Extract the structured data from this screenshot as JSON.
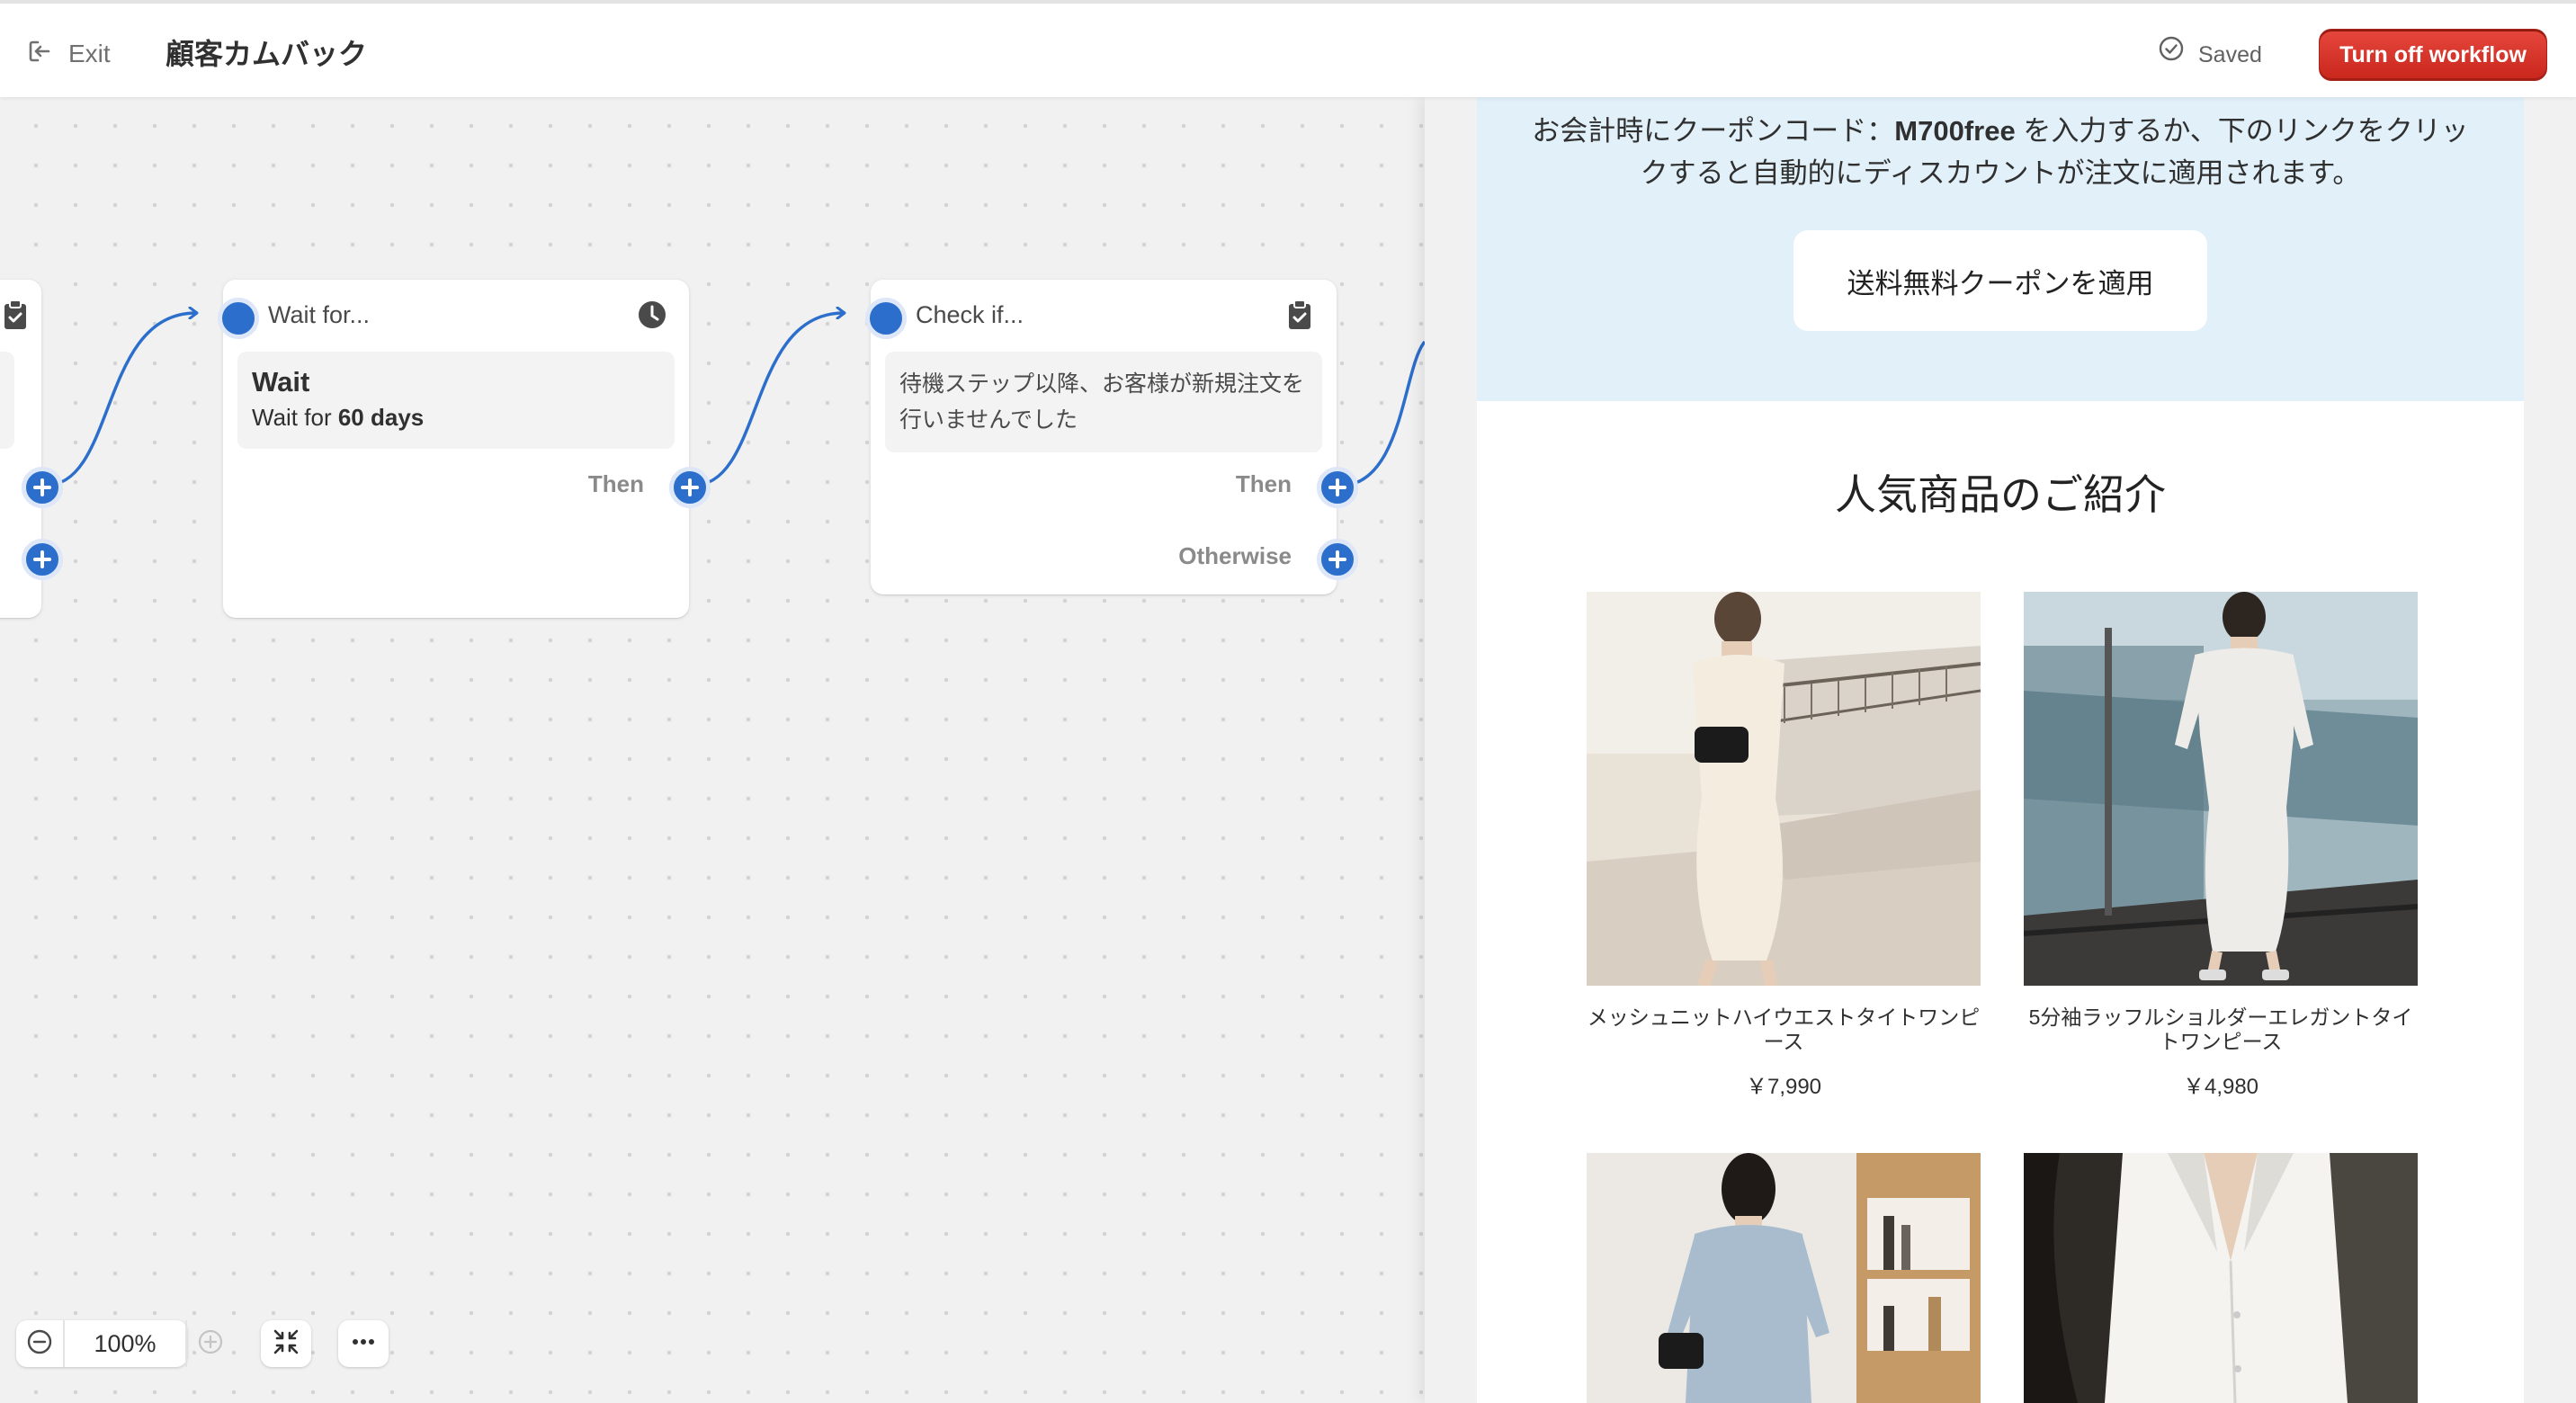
{
  "topbar": {
    "exit_label": "Exit",
    "workflow_title": "顧客カムバック",
    "saved_label": "Saved",
    "turn_off_label": "Turn off workflow"
  },
  "canvas": {
    "nodes": {
      "wait": {
        "header": "Wait for...",
        "heading": "Wait",
        "desc_prefix": "Wait for ",
        "desc_value": "60 days",
        "then_label": "Then"
      },
      "check": {
        "header": "Check if...",
        "condition": "待機ステップ以降、お客様が新規注文を行いませんでした",
        "then_label": "Then",
        "otherwise_label": "Otherwise"
      }
    },
    "zoom": {
      "level": "100%"
    },
    "icons": [
      "clipboard-check-icon",
      "clock-icon",
      "plus-circle-icon",
      "zoom-out-icon",
      "zoom-in-icon",
      "fit-view-icon",
      "more-horizontal-icon",
      "exit-icon",
      "check-circle-icon"
    ]
  },
  "email": {
    "coupon_text_pre": "お会計時にクーポンコード：",
    "coupon_code": "M700free",
    "coupon_text_post": " を入力するか、下のリンクをクリックすると自動的にディスカウントが注文に適用されます。",
    "coupon_button": "送料無料クーポンを適用",
    "popular_title": "人気商品のご紹介",
    "products": [
      {
        "name": "メッシュニットハイウエストタイトワンピース",
        "price": "￥7,990"
      },
      {
        "name": "5分袖ラッフルショルダーエレガントタイトワンピース",
        "price": "￥4,980"
      },
      {
        "name": "",
        "price": ""
      },
      {
        "name": "",
        "price": ""
      }
    ]
  },
  "colors": {
    "accent_blue": "#2c6ecb",
    "danger_red": "#e0362b",
    "coupon_bg": "#e1f0f9"
  }
}
